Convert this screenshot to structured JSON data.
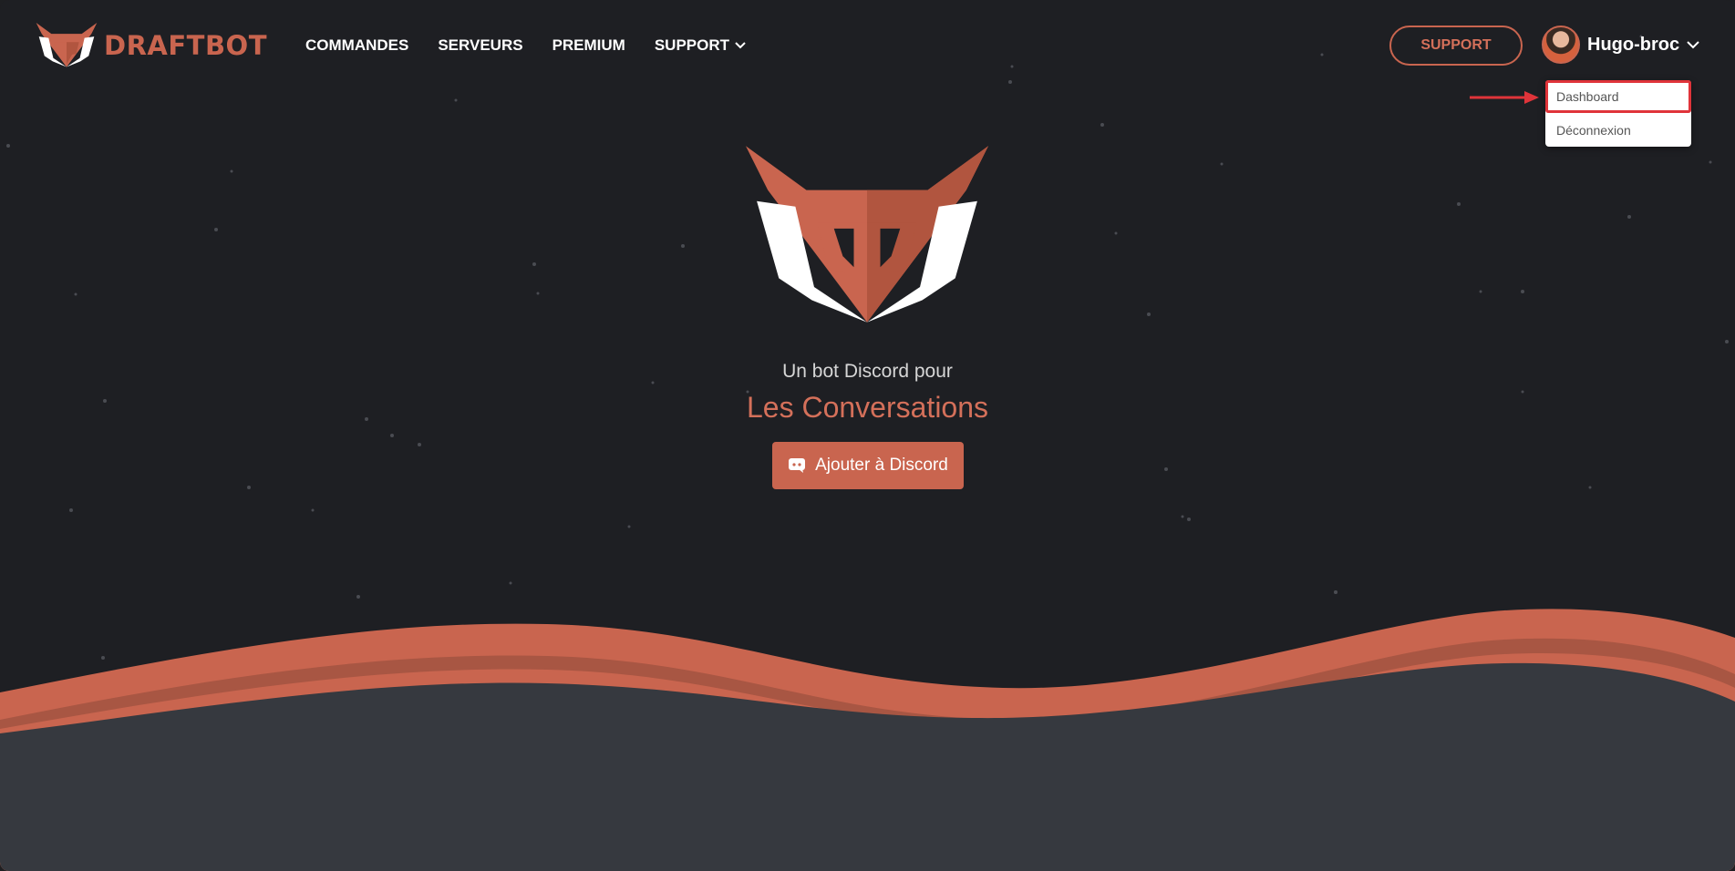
{
  "brand": {
    "name": "DRAFTBOT",
    "logo_icon": "draftbot-logo-icon"
  },
  "nav": {
    "items": [
      {
        "label": "COMMANDES"
      },
      {
        "label": "SERVEURS"
      },
      {
        "label": "PREMIUM"
      },
      {
        "label": "SUPPORT",
        "has_dropdown": true
      }
    ],
    "support_button": "SUPPORT",
    "user": {
      "name": "Hugo-broc",
      "avatar_icon": "user-avatar"
    }
  },
  "user_menu": {
    "items": [
      {
        "label": "Dashboard",
        "highlighted": true
      },
      {
        "label": "Déconnexion"
      }
    ]
  },
  "hero": {
    "subtitle": "Un bot Discord pour",
    "headline": "Les Conversations",
    "cta_label": "Ajouter à Discord",
    "cta_icon": "discord-icon"
  },
  "colors": {
    "accent": "#c9654f",
    "background": "#1e1f23",
    "lower_section": "#36393f",
    "highlight": "#e0343a"
  }
}
